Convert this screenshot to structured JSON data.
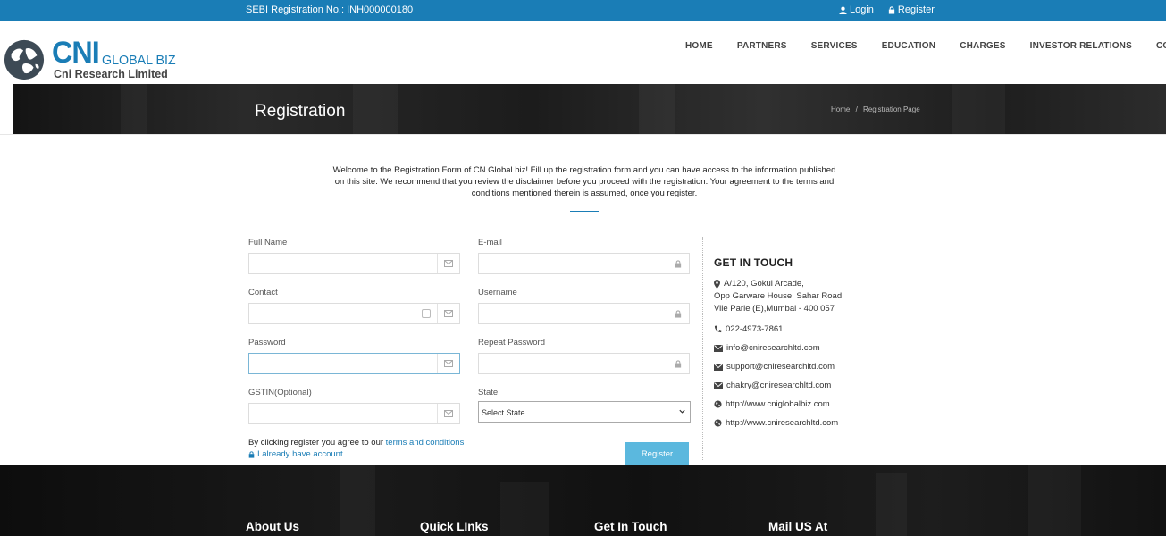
{
  "topbar": {
    "sebi": "SEBI Registration No.: INH000000180",
    "login": "Login",
    "register": "Register"
  },
  "brand": {
    "cni": "CNI",
    "global": "GLOBAL BIZ",
    "ltd": "Cni Research Limited",
    "color": "#1a7db6"
  },
  "nav": {
    "home": "HOME",
    "partners": "PARTNERS",
    "services": "SERVICES",
    "education": "EDUCATION",
    "charges": "CHARGES",
    "investor": "INVESTOR RELATIONS",
    "contact": "CONTACT US"
  },
  "banner": {
    "title": "Registration",
    "crumb_home": "Home",
    "crumb_sep": "/",
    "crumb_current": "Registration Page"
  },
  "intro": {
    "line1": "Welcome to the Registration Form of CN Global biz! Fill up the registration form and you can have access to the information published",
    "line2": "on this site. We recommend that you review the disclaimer before you proceed with the registration. Your agreement to the terms and",
    "line3": "conditions mentioned therein is assumed, once you register."
  },
  "form": {
    "full_name": {
      "label": "Full Name",
      "value": ""
    },
    "email": {
      "label": "E-mail",
      "value": ""
    },
    "contact": {
      "label": "Contact",
      "value": ""
    },
    "username": {
      "label": "Username",
      "value": ""
    },
    "password": {
      "label": "Password",
      "value": ""
    },
    "repeat_password": {
      "label": "Repeat Password",
      "value": ""
    },
    "gstin": {
      "label": "GSTIN(Optional)",
      "value": ""
    },
    "state": {
      "label": "State",
      "selected": "Select State"
    },
    "agree_text": "By clicking register you agree to our ",
    "terms_link": "terms and conditions",
    "already": "I already have account.",
    "register_button": "Register"
  },
  "contact": {
    "heading": "GET IN TOUCH",
    "address": [
      "A/120, Gokul Arcade,",
      "Opp Garware House, Sahar Road,",
      "Vile Parle (E),Mumbai - 400 057"
    ],
    "phone": "022-4973-7861",
    "emails": [
      "info@cniresearchltd.com",
      "support@cniresearchltd.com",
      "chakry@cniresearchltd.com"
    ],
    "sites": [
      "http://www.cniglobalbiz.com",
      "http://www.cniresearchltd.com"
    ]
  },
  "footer": {
    "about": "About Us",
    "quick": "Quick LInks",
    "touch": "Get In Touch",
    "mail": "Mail US At"
  }
}
